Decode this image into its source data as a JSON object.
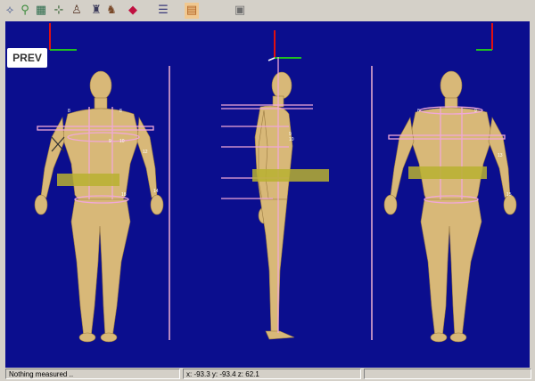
{
  "toolbar": {
    "icons": [
      "measure-tool-icon",
      "tape-tool-icon",
      "surface-tool-icon",
      "axis-tool-icon",
      "figure-tool-icon",
      "scan-tool-icon",
      "color-tool-icon",
      "layers-icon",
      "file-icon",
      "cube-icon"
    ]
  },
  "viewport": {
    "background": "#0b0e8e",
    "body_color": "#d8b878",
    "prev_label": "PREV",
    "front_labels": [
      "8",
      "8",
      "9",
      "10",
      "12",
      "14",
      "18"
    ],
    "side_labels": [
      "9",
      "10"
    ],
    "back_labels": [
      "8",
      "9",
      "13",
      "15"
    ]
  },
  "statusbar": {
    "message": "Nothing measured ..",
    "coords": "x: -93.3 y: -93.4 z: 62.1"
  }
}
